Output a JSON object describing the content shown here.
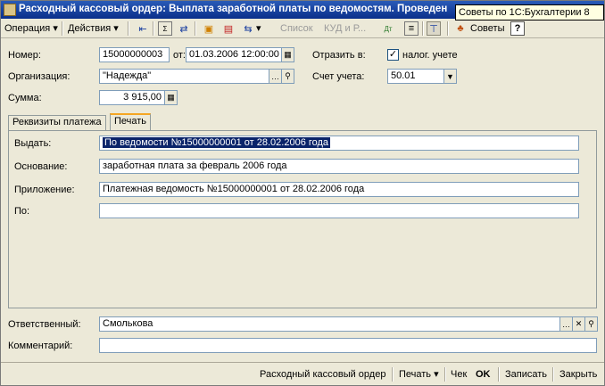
{
  "window": {
    "title": "Расходный кассовый ордер: Выплата заработной платы по ведомостям. Проведен",
    "tooltip": "Советы по 1С:Бухгалтерии 8"
  },
  "toolbar": {
    "operation": "Операция",
    "actions": "Действия",
    "list": "Список",
    "kud": "КУД и Р...",
    "tips": "Советы",
    "help": "?"
  },
  "form": {
    "number_label": "Номер:",
    "number_value": "15000000003",
    "from_label": "от:",
    "date_value": "01.03.2006 12:00:00",
    "reflect_label": "Отразить в:",
    "tax_accounting_label": "налог. учете",
    "tax_accounting_checked": true,
    "org_label": "Организация:",
    "org_value": "\"Надежда\"",
    "account_label": "Счет учета:",
    "account_value": "50.01",
    "sum_label": "Сумма:",
    "sum_value": "3 915,00"
  },
  "tabs": [
    "Реквизиты платежа",
    "Печать"
  ],
  "print_tab": {
    "issue_label": "Выдать:",
    "issue_value": "По ведомости №15000000001 от 28.02.2006 года",
    "basis_label": "Основание:",
    "basis_value": "заработная плата за февраль 2006 года",
    "attachment_label": "Приложение:",
    "attachment_value": "Платежная ведомость №15000000001 от 28.02.2006 года",
    "by_label": "По:",
    "by_value": ""
  },
  "bottom": {
    "responsible_label": "Ответственный:",
    "responsible_value": "Смолькова",
    "comment_label": "Комментарий:",
    "comment_value": ""
  },
  "footer": {
    "doc_name": "Расходный кассовый ордер",
    "print": "Печать",
    "check": "Чек",
    "ok": "OK",
    "save": "Записать",
    "close": "Закрыть"
  }
}
